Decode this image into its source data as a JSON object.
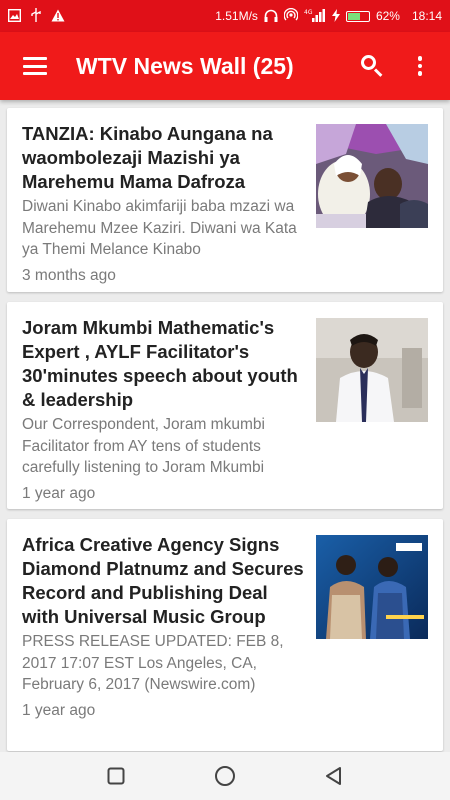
{
  "status_bar": {
    "network_speed": "1.51M/s",
    "signal": "4G",
    "battery": "62%",
    "battery_level": 0.62,
    "time": "18:14"
  },
  "app_bar": {
    "title": "WTV News Wall (25)",
    "menu_icon": "hamburger-menu-icon",
    "search_icon": "search-icon",
    "more_icon": "more-vert-icon"
  },
  "articles": [
    {
      "headline": "TANZIA: Kinabo Aungana na waombolezaji Mazishi ya Marehemu Mama Dafroza",
      "summary": "Diwani Kinabo akimfariji baba mzazi wa Marehemu Mzee Kaziri. Diwani wa Kata ya Themi Melance Kinabo",
      "time": "3 months ago"
    },
    {
      "headline": "Joram Mkumbi Mathematic's Expert , AYLF Facilitator's 30'minutes speech about youth & leadership",
      "summary": "Our Correspondent, Joram mkumbi Facilitator from AY tens of students carefully listening to Joram Mkumbi",
      "time": "1 year ago"
    },
    {
      "headline": "Africa Creative Agency Signs Diamond Platnumz and Secures Record and Publishing Deal with Universal Music Group",
      "summary": "PRESS RELEASE     UPDATED: FEB 8, 2017 17:07 EST Los Angeles, CA, February 6, 2017 (Newswire.com)",
      "time": "1 year ago"
    }
  ],
  "nav_bar": {
    "recents_icon": "square-recents-icon",
    "home_icon": "circle-home-icon",
    "back_icon": "triangle-back-icon"
  },
  "colors": {
    "status_bar": "#e01018",
    "app_bar": "#f01a1a",
    "background": "#ececec"
  }
}
